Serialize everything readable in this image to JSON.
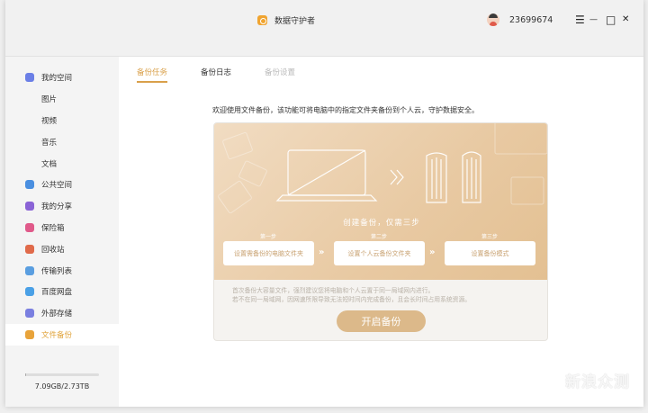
{
  "app": {
    "title": "数据守护者"
  },
  "user": {
    "id": "23699674"
  },
  "window_controls": {
    "menu": "☰",
    "minimize": "—",
    "maximize": "□",
    "close": "✕"
  },
  "sidebar": {
    "items": [
      {
        "label": "我的空间",
        "icon": "my-space-icon",
        "color": "#6b7fe6"
      },
      {
        "label": "图片"
      },
      {
        "label": "视频"
      },
      {
        "label": "音乐"
      },
      {
        "label": "文档"
      },
      {
        "label": "公共空间",
        "icon": "public-space-icon",
        "color": "#4a8fe0"
      },
      {
        "label": "我的分享",
        "icon": "share-icon",
        "color": "#8a63d6"
      },
      {
        "label": "保险箱",
        "icon": "safe-icon",
        "color": "#e05a8a"
      },
      {
        "label": "回收站",
        "icon": "recycle-bin-icon",
        "color": "#e06a4a"
      },
      {
        "label": "传输列表",
        "icon": "transfer-icon",
        "color": "#5a9ee0"
      },
      {
        "label": "百度网盘",
        "icon": "baidu-netdisk-icon",
        "color": "#4aa0e6"
      },
      {
        "label": "外部存储",
        "icon": "external-storage-icon",
        "color": "#7a7fe0"
      },
      {
        "label": "文件备份",
        "icon": "file-backup-icon",
        "color": "#e8a33a"
      }
    ],
    "storage": {
      "text": "7.09GB/2.73TB",
      "used_fraction": 0.0025
    }
  },
  "tabs": [
    {
      "label": "备份任务"
    },
    {
      "label": "备份日志"
    },
    {
      "label": "备份设置"
    }
  ],
  "intro": "欢迎使用文件备份，该功能可将电脑中的指定文件夹备份到个人云，守护数据安全。",
  "hero": {
    "title": "创建备份，仅需三步",
    "steps": [
      {
        "label": "第一步",
        "text": "设置需备份的电脑文件夹"
      },
      {
        "label": "第二步",
        "text": "设置个人云备份文件夹"
      },
      {
        "label": "第三步",
        "text": "设置备份模式"
      }
    ]
  },
  "notice": {
    "line1": "首次备份大容量文件，强烈建议您将电脑和个人云置于同一局域网内进行。",
    "line2": "若不在同一局域网，因网速所限导致无法短时间内完成备份，且会长时间占用系统资源。"
  },
  "start_button": "开启备份",
  "watermark": "新浪众测",
  "colors": {
    "accent": "#d9a04a",
    "hero": "#e8c9a2",
    "button": "#dcb98a"
  }
}
